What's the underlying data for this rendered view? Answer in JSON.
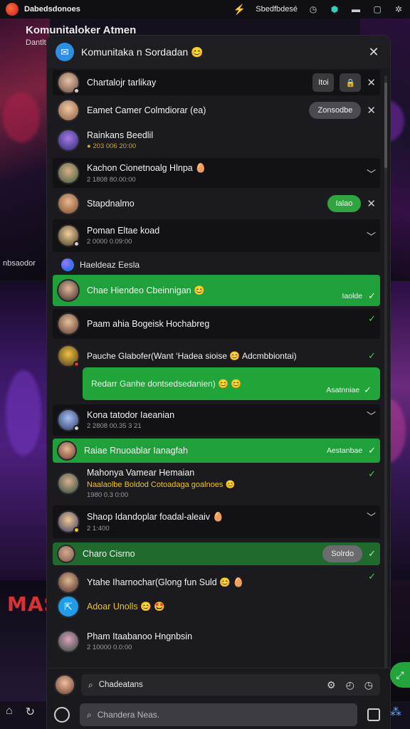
{
  "statusbar": {
    "title": "Dabedsdonoes",
    "right_text": "Sbedfbdesé"
  },
  "background": {
    "top_title": "Komunitaloker Atmen",
    "top_sub": "Dantlt",
    "side_label_1": "nbsaodor",
    "mass_text": "MAS"
  },
  "panel": {
    "title": "Komunitaka n Sordadan 😊"
  },
  "rows": [
    {
      "name": "Chartalojr tarlikay",
      "sub": "",
      "btn1": "Itoi",
      "btn2": "🔒"
    },
    {
      "name": "Eamet Camer Colmdiorar (ea)",
      "sub": "",
      "pill": "Zonsodbe"
    },
    {
      "name": "Rainkans Beedlil",
      "sub": "● 203 006 20:00"
    },
    {
      "name": "Kachon Cionetnoalg Hlnpa 🥚",
      "sub": "2 1808 80.00:00"
    },
    {
      "name": "Stapdnalmo",
      "sub": "",
      "pill": "Ialao"
    },
    {
      "name": "Poman Eltae koad",
      "sub": "2 0000 0.09:00"
    },
    {
      "name": "Chae Hiendeo Cbeinnigan 😊",
      "tag": "Iaolde"
    },
    {
      "name": "Paam ahia Bogeisk Hochabreg",
      "sub": ""
    },
    {
      "name": "Pauche Glabofer(Want ‘Hadea sioise 😊 Adcmbbiontai)",
      "sub": ""
    },
    {
      "name": "Redarr Ganhe dontsedsedanien) 😊 😊",
      "tag": "Asatnniae"
    },
    {
      "name": "Kona tatodor Iaeanian",
      "sub": "2 2808 00.35 3 21"
    },
    {
      "name": "Raiae Rnuoablar Ianagfah",
      "tag": "Aestanbae"
    },
    {
      "name": "Mahonya Vamear Hemaian",
      "sub": "Naalaolbe Boldod Cotoadaga goalnoes 😊",
      "sub2": "1980 0.3 0:00"
    },
    {
      "name": "Shaop Idandoplar foadal-aleaiv 🥚",
      "sub": "2 1:400"
    },
    {
      "name": "Charo Cisrno",
      "pill": "Solrdo"
    },
    {
      "name": "Ytahe Iharnochar(Glong fun Suld 😊 🥚",
      "sub": ""
    },
    {
      "name": "Adoar Unolls 😊 🤩",
      "sub": ""
    },
    {
      "name": "Pham Itaabanoo Hngnbsin",
      "sub": "2 10000 0.0:00"
    }
  ],
  "section": {
    "label": "Haeldeaz Eesla"
  },
  "compose": {
    "search_value": "Chadeatans",
    "message_placeholder": "Chandera Neas."
  }
}
